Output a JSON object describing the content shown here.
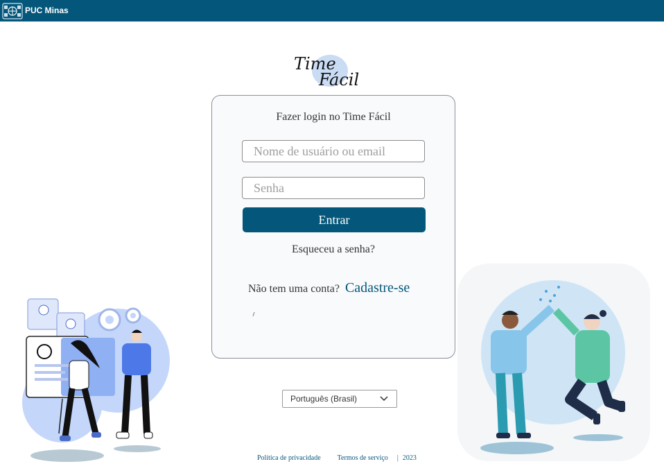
{
  "header": {
    "brand_name": "PUC Minas",
    "brand_logo_icon": "puc-minas-crest-icon",
    "bar_color": "#04577a"
  },
  "app_logo": {
    "line1": "Time",
    "line2": "Fácil"
  },
  "login": {
    "title": "Fazer login no Time Fácil",
    "username_placeholder": "Nome de usuário ou email",
    "username_value": "",
    "password_placeholder": "Senha",
    "password_value": "",
    "submit_label": "Entrar",
    "forgot_label": "Esqueceu a senha?",
    "signup_question": "Não tem uma conta?",
    "signup_link": "Cadastre-se"
  },
  "language": {
    "selected": "Português (Brasil)"
  },
  "footer": {
    "privacy": "Política de privacidade",
    "terms": "Termos de serviço",
    "separator": "|",
    "year": "2023"
  },
  "colors": {
    "accent": "#04577a",
    "card_background": "#f9fafc",
    "illustration_blue": "#b9cdf7"
  }
}
